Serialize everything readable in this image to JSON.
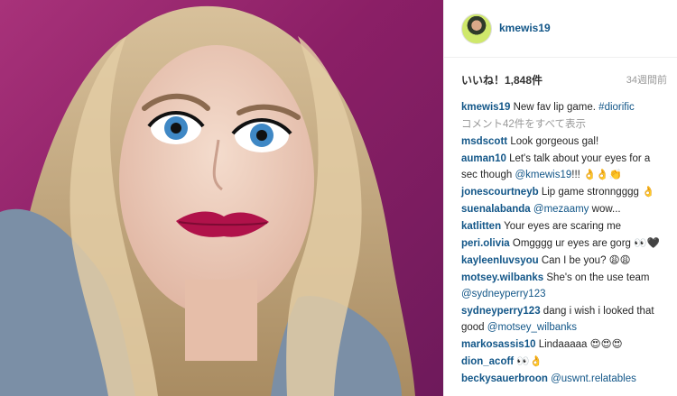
{
  "post": {
    "username": "kmewis19",
    "likes": "いいね！1,848件",
    "time_ago": "34週間前",
    "caption_text": "New fav lip game.",
    "caption_tag": "#diorific",
    "view_all": "コメント42件をすべて表示"
  },
  "comments": [
    {
      "user": "msdscott",
      "text": "Look gorgeous gal!",
      "mention": "",
      "after": ""
    },
    {
      "user": "auman10",
      "text": "Let's talk about your eyes for a sec though",
      "mention": "@kmewis19",
      "after": "!!! 👌👌👏"
    },
    {
      "user": "jonescourtneyb",
      "text": "Lip game stronngggg",
      "mention": "",
      "after": " 👌"
    },
    {
      "user": "suenalabanda",
      "text": "",
      "mention": "@mezaamy",
      "after": " wow..."
    },
    {
      "user": "katlitten",
      "text": "Your eyes are scaring me",
      "mention": "",
      "after": ""
    },
    {
      "user": "peri.olivia",
      "text": "Omgggg ur eyes are gorg",
      "mention": "",
      "after": "👀🖤"
    },
    {
      "user": "kayleenluvsyou",
      "text": "Can I be you?",
      "mention": "",
      "after": " 😩😩"
    },
    {
      "user": "motsey.wilbanks",
      "text": "She's on the use team",
      "mention": "@sydneyperry123",
      "after": ""
    },
    {
      "user": "sydneyperry123",
      "text": "dang i wish i looked that good",
      "mention": "@motsey_wilbanks",
      "after": ""
    },
    {
      "user": "markosassis10",
      "text": "Lindaaaaa",
      "mention": "",
      "after": " 😍😍😍"
    },
    {
      "user": "dion_acoff",
      "text": "",
      "mention": "",
      "after": "👀👌"
    },
    {
      "user": "beckysauerbroon",
      "text": "",
      "mention": "@uswnt.relatables",
      "after": ""
    }
  ]
}
